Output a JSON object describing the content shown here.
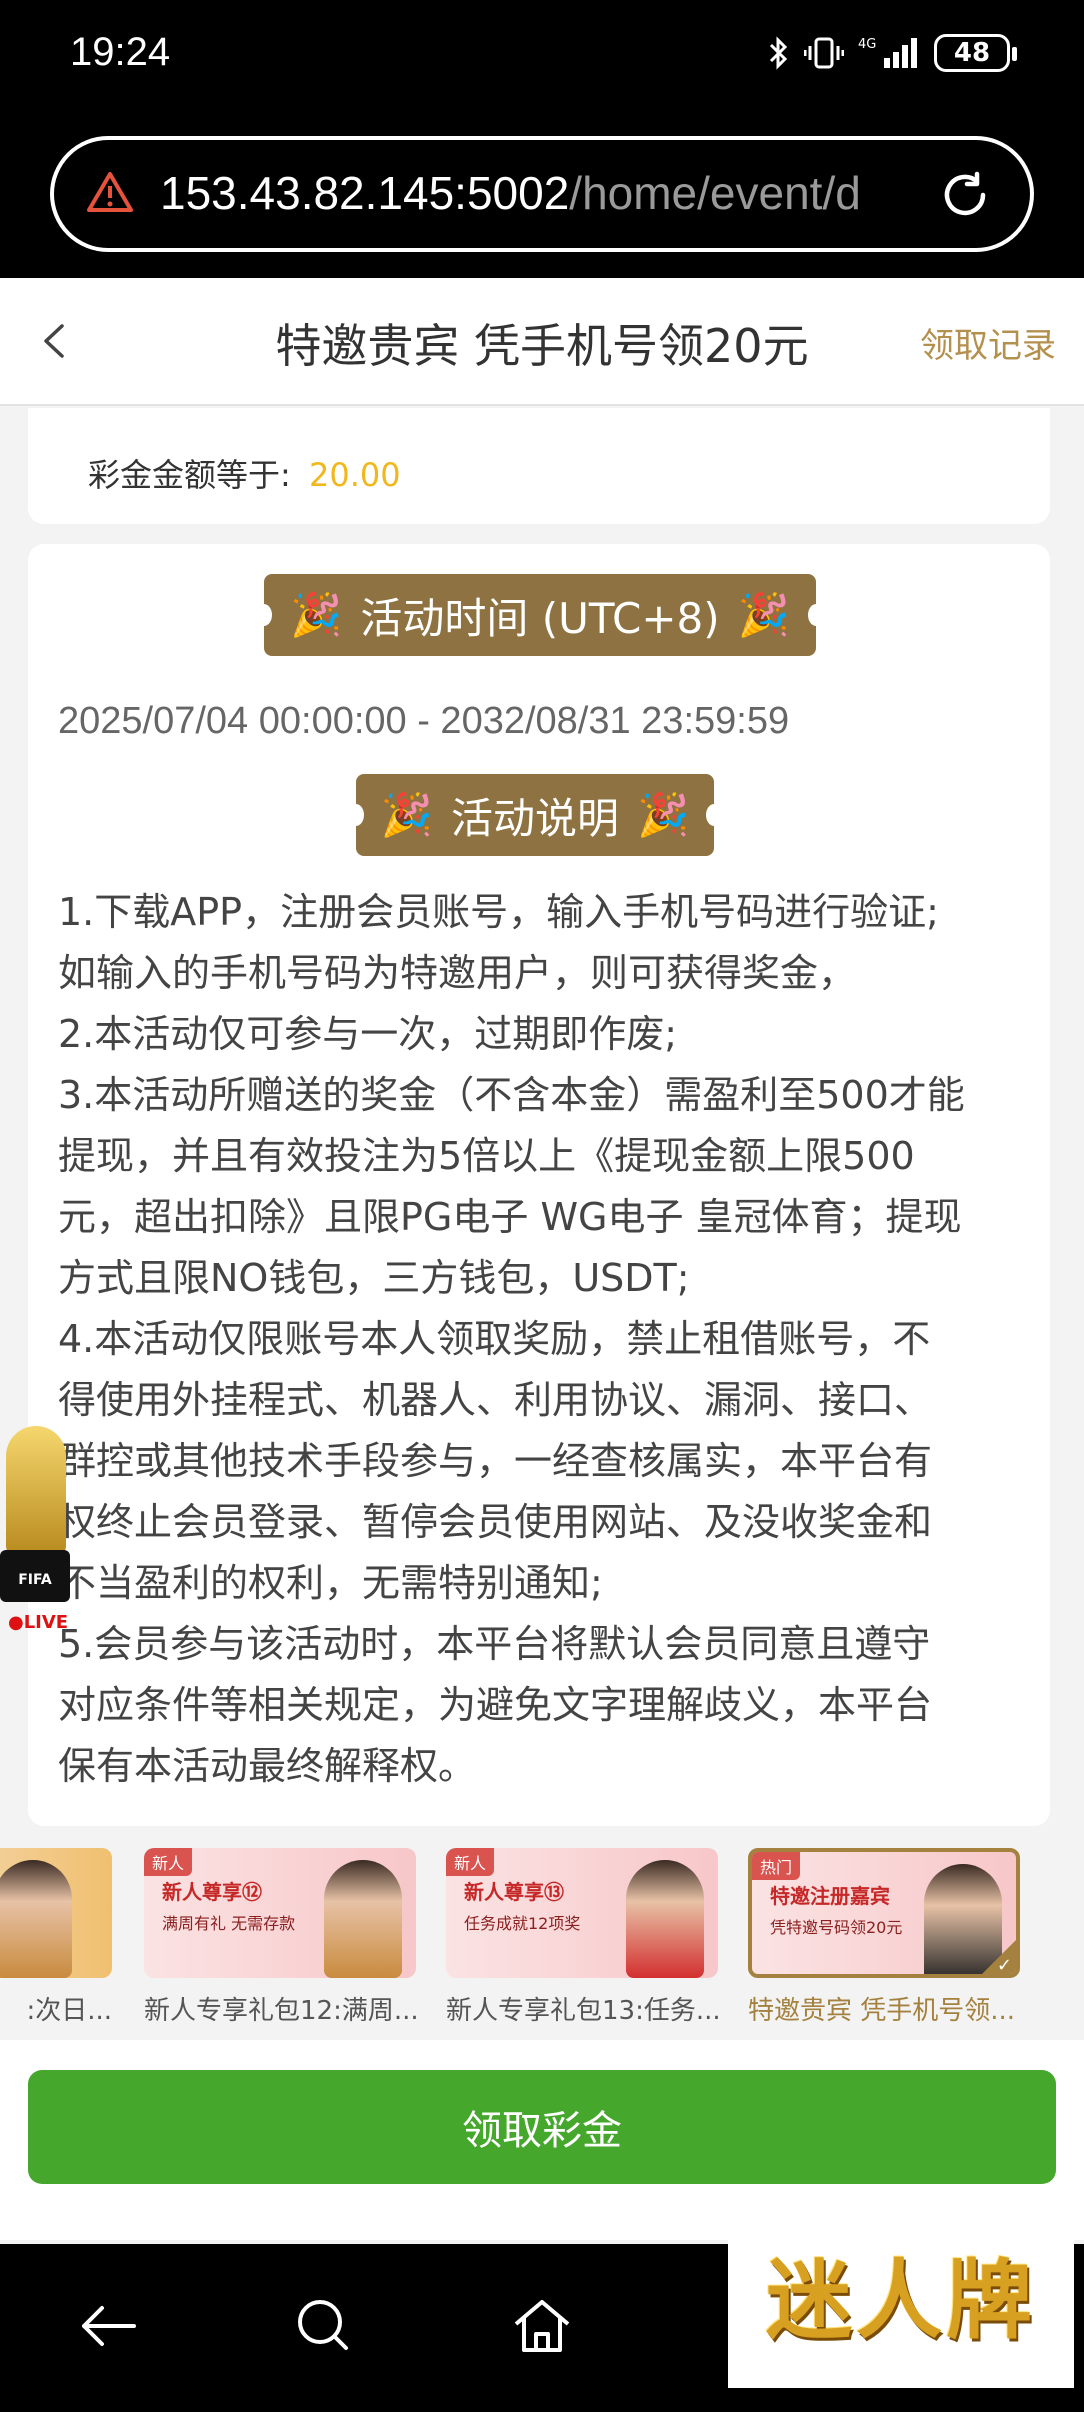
{
  "status_bar": {
    "time": "19:24",
    "battery": "48"
  },
  "url_bar": {
    "host": "153.43.82.145:5002",
    "path": "/home/event/d"
  },
  "header": {
    "title": "特邀贵宾 凭手机号领20元",
    "records": "领取记录"
  },
  "bonus": {
    "label": "彩金金额等于:",
    "value": "20.00"
  },
  "activity_time": {
    "title": "活动时间 (UTC+8)",
    "range": "2025/07/04 00:00:00 - 2032/08/31 23:59:59"
  },
  "activity_desc": {
    "title": "活动说明",
    "lines": [
      "1.下载APP，注册会员账号，输入手机号码进行验证;",
      "如输入的手机号码为特邀用户，则可获得奖金，",
      "2.本活动仅可参与一次，过期即作废;",
      "3.本活动所赠送的奖金（不含本金）需盈利至500才能",
      "提现，并且有效投注为5倍以上《提现金额上限500",
      "元，超出扣除》且限PG电子 WG电子 皇冠体育；提现",
      "方式且限NO钱包，三方钱包，USDT;",
      "4.本活动仅限账号本人领取奖励，禁止租借账号，不",
      "得使用外挂程式、机器人、利用协议、漏洞、接口、",
      "群控或其他技术手段参与，一经查核属实，本平台有",
      "权终止会员登录、暂停会员使用网站、及没收奖金和",
      "不当盈利的权利，无需特别通知;",
      "5.会员参与该活动时，本平台将默认会员同意且遵守",
      "对应条件等相关规定，为避免文字理解歧义，本平台",
      "保有本活动最终解释权。"
    ]
  },
  "promos": [
    {
      "label": ":次日...",
      "badge": "",
      "title": "",
      "sub": ""
    },
    {
      "label": "新人专享礼包12:满周...",
      "badge": "新人",
      "title": "新人尊享⑫",
      "sub": "满周有礼 无需存款"
    },
    {
      "label": "新人专享礼包13:任务...",
      "badge": "新人",
      "title": "新人尊享⑬",
      "sub": "任务成就12项奖"
    },
    {
      "label": "特邀贵宾 凭手机号领...",
      "badge": "热门",
      "title": "特邀注册嘉宾",
      "sub": "凭特邀号码领20元"
    }
  ],
  "fifa_widget": {
    "text": "FIFA",
    "live": "●LIVE"
  },
  "claim_button": "领取彩金",
  "brand_logo": "迷人牌",
  "icons": {
    "warning": "warning-triangle-icon",
    "reload": "reload-icon",
    "back": "chevron-left-icon",
    "nav_back": "back-arrow-icon",
    "nav_search": "search-icon",
    "nav_home": "home-icon"
  },
  "colors": {
    "gold": "#8e7241",
    "accent_gold": "#b4904e",
    "green": "#46a72d",
    "amount": "#f0b81c"
  }
}
